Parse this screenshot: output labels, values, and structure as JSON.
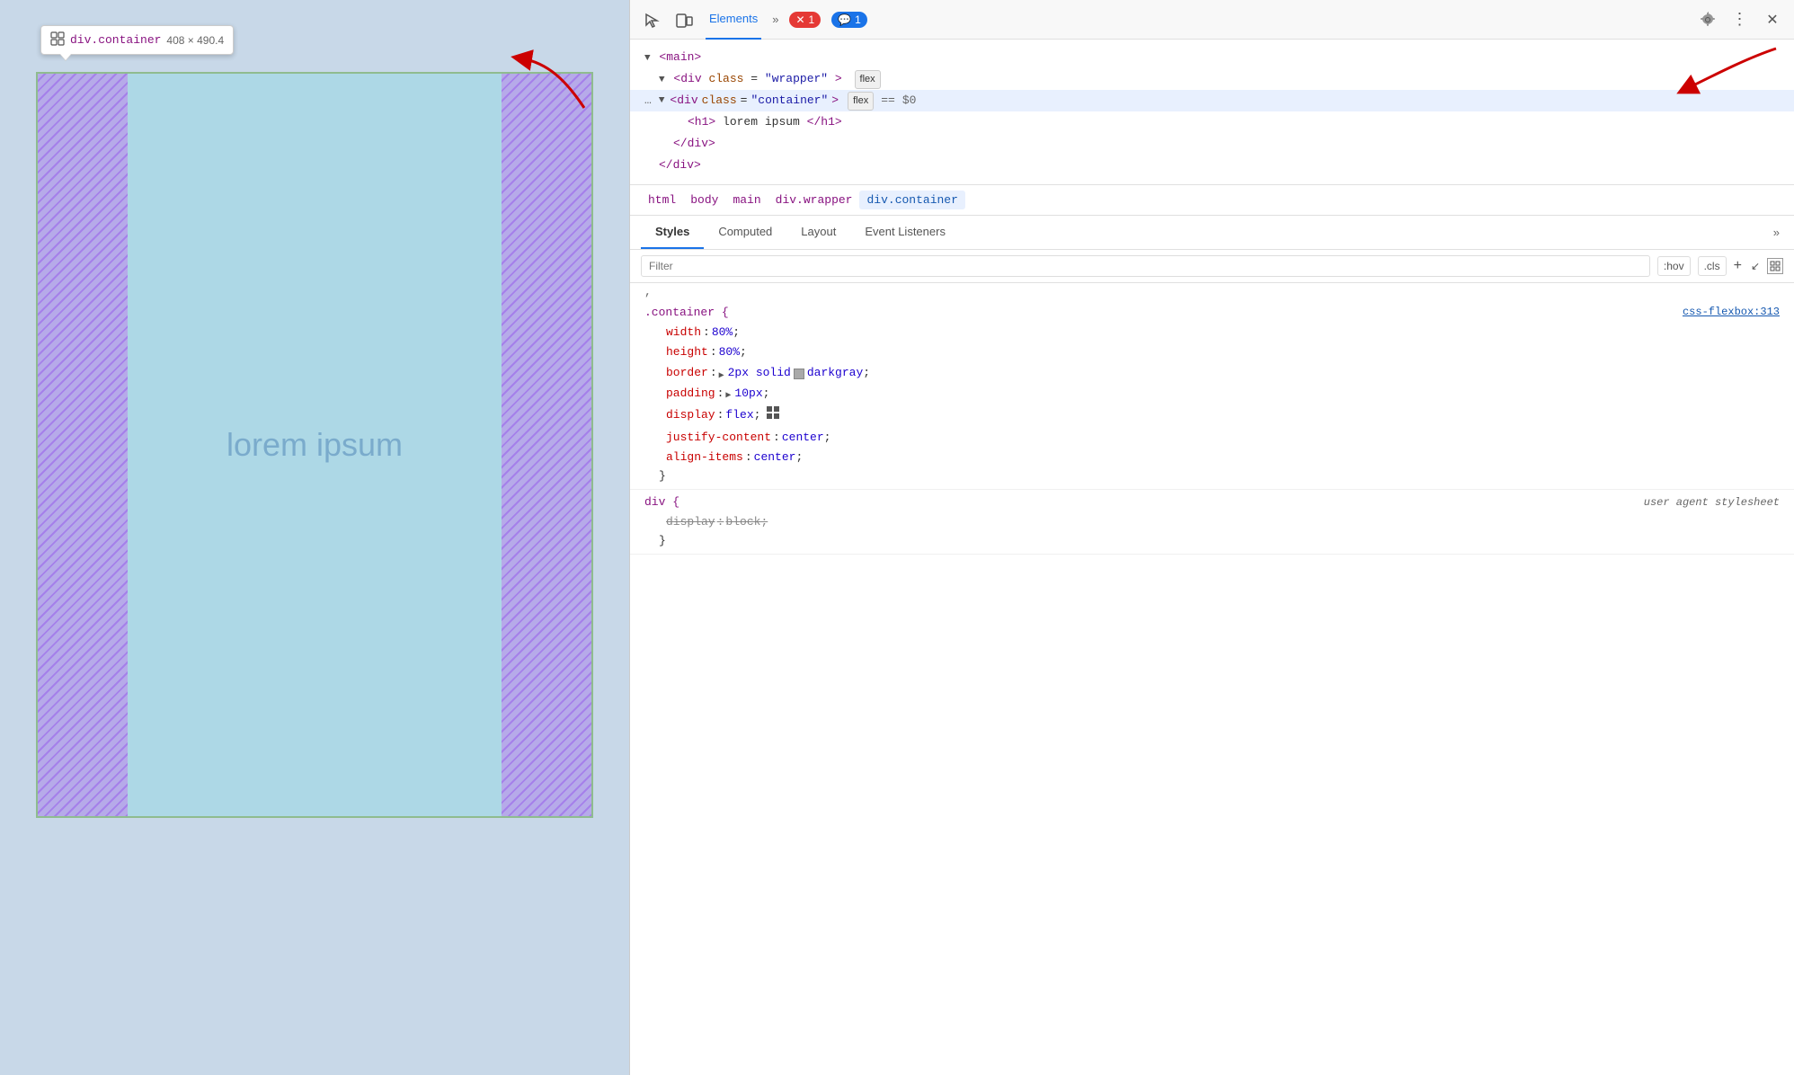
{
  "preview": {
    "tooltip": {
      "element": "div.container",
      "dimensions": "408 × 490.4"
    },
    "lorem_text": "lorem ipsum"
  },
  "devtools": {
    "toolbar": {
      "tabs": [
        "Elements"
      ],
      "active_tab": "Elements",
      "error_count": "1",
      "info_count": "1"
    },
    "dom": {
      "lines": [
        {
          "indent": 0,
          "content": "<main>"
        },
        {
          "indent": 1,
          "content": "<div class=\"wrapper\">",
          "badge": "flex"
        },
        {
          "indent": 2,
          "content": "<div class=\"container\">",
          "badge": "flex",
          "selected": true,
          "equals": "==",
          "dollar": "$0"
        },
        {
          "indent": 3,
          "content": "<h1>lorem ipsum</h1>"
        },
        {
          "indent": 2,
          "content": "</div>"
        },
        {
          "indent": 1,
          "content": "</div>"
        }
      ]
    },
    "breadcrumb": {
      "items": [
        "html",
        "body",
        "main",
        "div.wrapper",
        "div.container"
      ]
    },
    "sub_tabs": {
      "tabs": [
        "Styles",
        "Computed",
        "Layout",
        "Event Listeners"
      ],
      "active": "Styles"
    },
    "filter": {
      "placeholder": "Filter",
      "hov_label": ":hov",
      "cls_label": ".cls"
    },
    "styles": {
      "rules": [
        {
          "selector": ".container {",
          "source": "css-flexbox:313",
          "properties": [
            {
              "name": "width",
              "value": "80%",
              "type": "normal"
            },
            {
              "name": "height",
              "value": "80%",
              "type": "normal"
            },
            {
              "name": "border",
              "value": "2px solid",
              "color": "#a9a9a9",
              "color_name": "darkgray",
              "type": "color"
            },
            {
              "name": "padding",
              "value": "10px",
              "type": "expand"
            },
            {
              "name": "display",
              "value": "flex",
              "type": "flex"
            },
            {
              "name": "justify-content",
              "value": "center",
              "type": "normal"
            },
            {
              "name": "align-items",
              "value": "center",
              "type": "normal"
            }
          ]
        },
        {
          "selector": "div {",
          "source_italic": "user agent stylesheet",
          "properties": [
            {
              "name": "display",
              "value": "block",
              "type": "strikethrough"
            }
          ]
        }
      ]
    }
  }
}
